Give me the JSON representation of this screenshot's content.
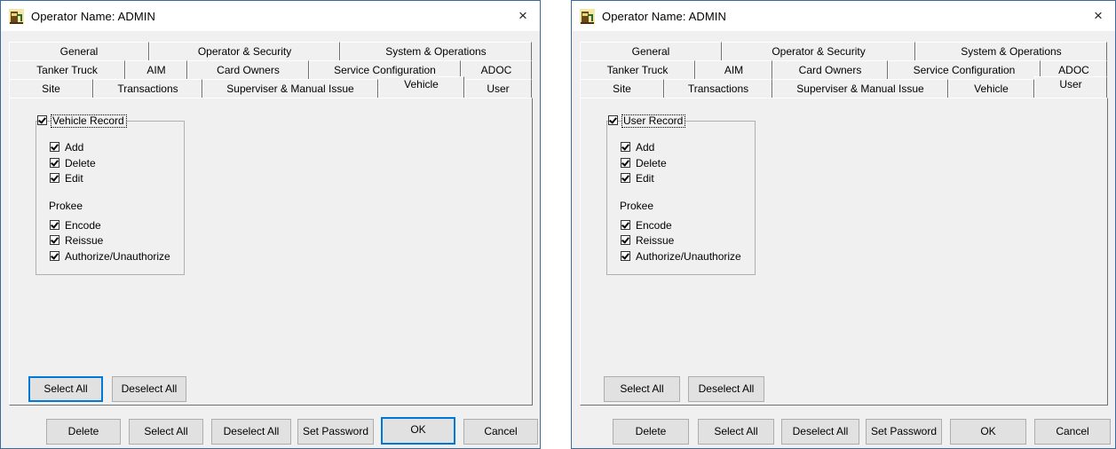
{
  "dialogs": [
    {
      "title": "Operator Name: ADMIN",
      "close_glyph": "×",
      "tabs_row1": [
        "General",
        "Operator & Security",
        "System & Operations"
      ],
      "tabs_row2": [
        "Tanker Truck",
        "AIM",
        "Card Owners",
        "Service Configuration",
        "ADOC"
      ],
      "tabs_row3": [
        "Site",
        "Transactions",
        "Superviser & Manual Issue",
        "Vehicle",
        "User"
      ],
      "active_tab": "Vehicle",
      "group_title": "Vehicle Record",
      "perm_items": [
        "Add",
        "Delete",
        "Edit"
      ],
      "prokee_label": "Prokee",
      "prokee_items": [
        "Encode",
        "Reissue",
        "Authorize/Unauthorize"
      ],
      "panel_select_all": "Select All",
      "panel_deselect_all": "Deselect All",
      "footer": [
        "Delete",
        "Select All",
        "Deselect All",
        "Set Password",
        "OK",
        "Cancel"
      ]
    },
    {
      "title": "Operator Name: ADMIN",
      "close_glyph": "×",
      "tabs_row1": [
        "General",
        "Operator & Security",
        "System & Operations"
      ],
      "tabs_row2": [
        "Tanker Truck",
        "AIM",
        "Card Owners",
        "Service Configuration",
        "ADOC"
      ],
      "tabs_row3": [
        "Site",
        "Transactions",
        "Superviser & Manual Issue",
        "Vehicle",
        "User"
      ],
      "active_tab": "User",
      "group_title": "User Record",
      "perm_items": [
        "Add",
        "Delete",
        "Edit"
      ],
      "prokee_label": "Prokee",
      "prokee_items": [
        "Encode",
        "Reissue",
        "Authorize/Unauthorize"
      ],
      "panel_select_all": "Select All",
      "panel_deselect_all": "Deselect All",
      "footer": [
        "Delete",
        "Select All",
        "Deselect All",
        "Set Password",
        "OK",
        "Cancel"
      ]
    }
  ],
  "icons": {
    "app": "fuel-station-icon",
    "close": "close-icon",
    "checkbox": "checkmark-icon"
  },
  "colors": {
    "window_border": "#3c6a9a",
    "dialog_bg": "#f0f0f0",
    "default_button_border": "#0078d7"
  }
}
